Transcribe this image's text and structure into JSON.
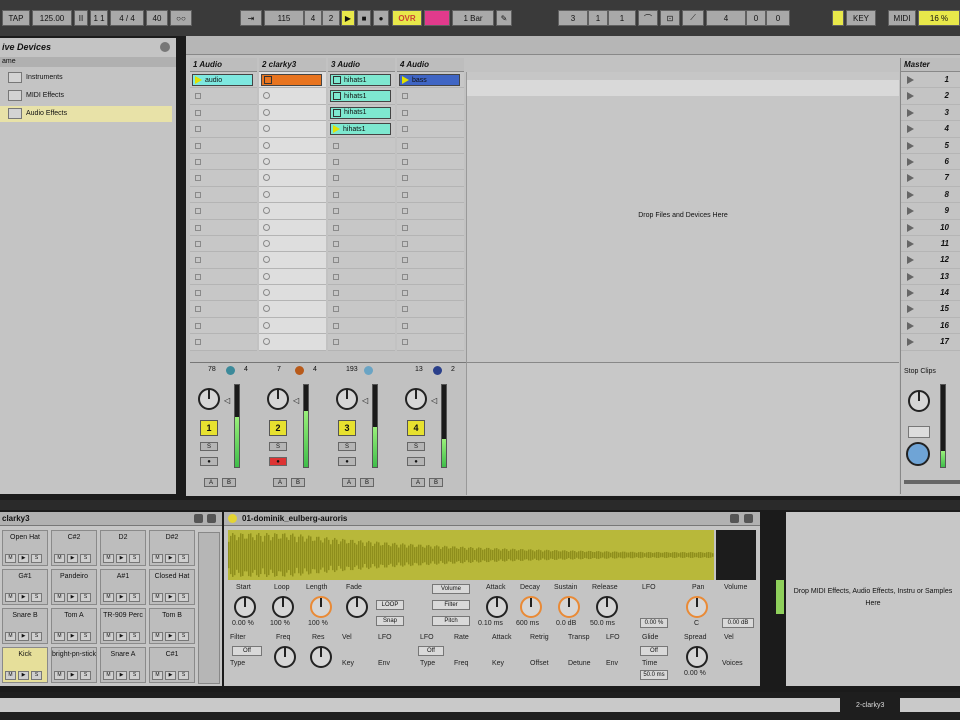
{
  "transport": {
    "tap": "TAP",
    "tempo": "125.00",
    "tempo_nudge": "II",
    "time_sig_a": "1 1",
    "time_sig_b": "4 / 4",
    "quantize": "40",
    "ovr": "OVR",
    "bar": "1 Bar",
    "position": "115",
    "pos_beat": "4",
    "pos_sixteenth": "2",
    "loop_start": "3",
    "loop_beat": "1",
    "loop_six": "1",
    "loop_len": "4",
    "loop_len_b": "0",
    "loop_len_c": "0",
    "key": "KEY",
    "midi": "MIDI",
    "cpu": "16 %"
  },
  "browser": {
    "title": "ive Devices",
    "col_header": "ame",
    "items": [
      "Instruments",
      "MIDI Effects",
      "Audio Effects"
    ]
  },
  "tracks": [
    {
      "name": "1 Audio",
      "clips": [
        {
          "row": 0,
          "label": "audio",
          "color": "#7ee8e0",
          "playing": true
        }
      ],
      "vol": "78",
      "pan_val": "4",
      "number": "1"
    },
    {
      "name": "2 clarky3",
      "clips": [
        {
          "row": 0,
          "label": "",
          "color": "#e8741f",
          "playing": false
        }
      ],
      "vol": "7",
      "pan_val": "4",
      "number": "2"
    },
    {
      "name": "3 Audio",
      "clips": [
        {
          "row": 0,
          "label": "hihats1",
          "color": "#7ee8d0",
          "playing": false
        },
        {
          "row": 1,
          "label": "hihats1",
          "color": "#7ee8d0",
          "playing": false
        },
        {
          "row": 2,
          "label": "hihats1",
          "color": "#7ee8d0",
          "playing": false
        },
        {
          "row": 3,
          "label": "hihats1",
          "color": "#7ee8d0",
          "playing": true
        }
      ],
      "vol": "193",
      "pan_val": "",
      "number": "3"
    },
    {
      "name": "4 Audio",
      "clips": [
        {
          "row": 0,
          "label": "bass",
          "color": "#3f65c4",
          "playing": true
        }
      ],
      "vol": "13",
      "pan_val": "2",
      "number": "4"
    }
  ],
  "drop_area": "Drop Files and Devices Here",
  "master": {
    "title": "Master",
    "scenes": [
      "1",
      "2",
      "3",
      "4",
      "5",
      "6",
      "7",
      "8",
      "9",
      "10",
      "11",
      "12",
      "13",
      "14",
      "15",
      "16",
      "17"
    ],
    "stop_clips": "Stop Clips"
  },
  "drum_rack": {
    "title": "clarky3",
    "pads": [
      "Open Hat",
      "C#2",
      "D2",
      "D#2",
      "G#1",
      "Pandeiro",
      "A#1",
      "Closed Hat",
      "Snare B",
      "Tom A",
      "TR-909 Perc",
      "Tom B",
      "Kick",
      "bright-pn-stick",
      "Snare A",
      "C#1"
    ]
  },
  "simpler": {
    "title": "01-dominik_eulberg-auroris",
    "labels": {
      "start": "Start",
      "loop": "Loop",
      "length": "Length",
      "fade": "Fade",
      "volume": "Volume",
      "filter": "Filter",
      "pitch": "Pitch",
      "attack": "Attack",
      "decay": "Decay",
      "sustain": "Sustain",
      "release": "Release",
      "lfo": "LFO",
      "pan": "Pan",
      "volume2": "Volume",
      "filter2": "Filter",
      "freq": "Freq",
      "res": "Res",
      "vel": "Vel",
      "lfo2": "LFO",
      "rate": "Rate",
      "retrig": "Retrig",
      "transp": "Transp",
      "glide": "Glide",
      "spread": "Spread",
      "type": "Type",
      "key": "Key",
      "env": "Env",
      "offset": "Offset",
      "detune": "Detune",
      "time": "Time",
      "voices": "Voices"
    },
    "values": {
      "start": "0.00 %",
      "loop": "100 %",
      "length": "100 %",
      "attack": "0.10 ms",
      "decay": "600 ms",
      "sustain": "0.0 dB",
      "release": "50.0 ms",
      "lfo_rate": "0.00 %",
      "pan": "C",
      "vol": "0.00 dB",
      "spread": "0.00 %",
      "glide": "Off",
      "time": "50.0 ms",
      "off": "Off",
      "loop_btn": "LOOP",
      "snap": "Snap"
    }
  },
  "fx_drop": "Drop MIDI Effects, Audio Effects, Instru or Samples Here",
  "status": {
    "right_label": "2-clarky3"
  }
}
